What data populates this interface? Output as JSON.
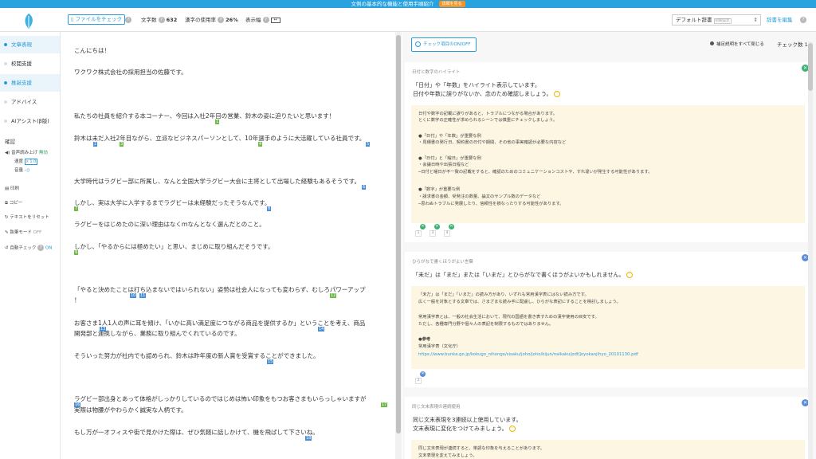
{
  "banner": {
    "text": "文例の基本的な機能と使用手順紹介",
    "button": "詳細を見る"
  },
  "header": {
    "file_check": "ファイルをチェック",
    "char_count_label": "文字数",
    "char_count": "632",
    "kanji_rate_label": "漢字の使用率",
    "kanji_rate": "26%",
    "display_width_label": "表示幅",
    "dict_select": "デフォルト辞書",
    "dict_tag": "初期設定",
    "dict_edit": "辞書を編集"
  },
  "sidebar": {
    "items": [
      {
        "label": "文章表現"
      },
      {
        "label": "校閲支援"
      },
      {
        "label": "推敲支援"
      },
      {
        "label": "アドバイス"
      },
      {
        "label": "AIアシスト(β版)"
      }
    ],
    "confirm_label": "確認",
    "tts_label": "音声読み上げ",
    "tts_status": "無効",
    "speed_label": "速度",
    "speed_value": "x 1.0",
    "volume_label": "音量",
    "print": "印刷",
    "copy": "コピー",
    "reset": "テキストをリセット",
    "draft_mode": "執筆モード",
    "draft_status": "OFF",
    "auto_check": "自動チェック",
    "auto_status": "ON"
  },
  "editor": {
    "lines": [
      "こんにちは！",
      "ワクワク株式会社の採用担当の佐藤です。",
      "私たちの社員を紹介する本コーナー、今回は入社2年目の営業、鈴木の姿に迫りたいと思います！",
      "鈴木は未だ入社2年目ながら、立派なビジネスパーソンとして、10年選手のように大活躍している社員です。",
      "大学時代はラグビー部に所属し、なんと全国大学ラグビー大会に主将として出場した経験もあるそうです。",
      "しかし、実は大学に入学するまでラグビーは未経験だったそうなんです。",
      "ラグビーをはじめたのに深い理由はなくｍなんとなく選んだとのこと。",
      "しかし、「やるからには極めたい」と思い、まじめに取り組んだそうです。",
      "「やると決めたことは打ち込まないではいられない」姿勢は社会人になっても変わらず、むしろパワーアップ",
      "！",
      "お客さま1人1人の声に耳を傾け、「いかに高い満足度につながる商品を提供するか」ということを考え、商品",
      "開発部と連携しながら、業務に取り組んでくれているのです。",
      "そういった努力が社内でも認められ、鈴木は昨年度の新人賞を受賞することができました。",
      "ラグビー部出身とあって体格がしっかりしているのではじめは怖い印象をもつお客さまもいらっしゃいますが",
      "実際は物腰がやわらかく誠実な人柄です。",
      "もし万が一オフィスや街で見かけた際は、ぜひ気軽に話しかけて、機を飛ばして下さいね。"
    ],
    "markers": [
      "1",
      "2",
      "3",
      "4",
      "5",
      "6",
      "7",
      "8",
      "9",
      "10",
      "11",
      "12",
      "13",
      "14",
      "15",
      "16",
      "17",
      "18",
      "19"
    ]
  },
  "panel": {
    "toggle_label": "チェック項目のON/OFF",
    "close_all": "補足説明をすべて閉じる",
    "check_count": "チェック数 19",
    "cards": [
      {
        "category": "日付と数字のハイライト",
        "lines": [
          "「日付」や「年数」をハイライト表示しています。",
          "日付や年数に誤りがないか、念のため確認しましょう。"
        ],
        "box": [
          "日付や数字の記載に誤りがあると、トラブルにつながる場合があります。",
          "とくに数字の正確性が求められるシーンでは慎重にチェックしましょう。",
          "●「日付」や「年数」が重要な例",
          "・見積書の発行日、契約書の日付や期間、その他の事実確認が必要な内容など",
          "●「日付」と「曜日」が重要な例",
          "・会議日時や出張日程など",
          "─日付と曜日が不一致の記載をすると、確認のためのコミュニケーションコストや、すれ違いが発生する可能性があります。",
          "●「数字」が重要な例",
          "・請求書の金額、受発注の数量、論文のサンプル数のデータなど",
          "─思わぬトラブルに発展したり、信頼性を損なったりする可能性があります。"
        ],
        "nums": [
          "1",
          "3",
          "4"
        ]
      },
      {
        "category": "ひらがなで書くほうがよい言葉",
        "lines": [
          "「未だ」は「まだ」または「いまだ」とひらがなで書くほうがよいかもしれません。"
        ],
        "box": [
          "「未だ」は「まだ」「いまだ」の読み方があり、いずれも常用漢字表にはない読み方です。",
          "広く一般を対象とする文章では、さまざまな読み手に配慮し、ひらがな表記にすることを検討しましょう。",
          "常用漢字表とは、一般の社会生活において、現代の国語を書き表すための漢字使用の目安です。",
          "ただし、各種専門分野や個々人の表記を制限するものではありません。",
          "●参考",
          "常用漢字表（文化庁）",
          "https://www.bunka.go.jp/kokugo_nihongo/sisaku/joho/joho/kijun/naikaku/pdf/joyokanjihyo_20101130.pdf"
        ],
        "nums": [
          "2"
        ]
      },
      {
        "category": "同じ文末表現の連続使用",
        "lines": [
          "同じ文末表現を3連続以上使用しています。",
          "文末表現に変化をつけてみましょう。"
        ],
        "box": [
          "同じ文末表現が連続すると、単調な印象を与えることがあります。",
          "文末表現を変えてみましょう。"
        ]
      }
    ]
  }
}
